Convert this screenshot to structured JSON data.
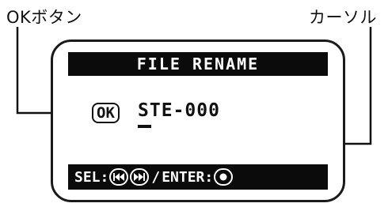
{
  "callouts": {
    "ok_button": "OKボタン",
    "cursor": "カーソル"
  },
  "screen": {
    "title": "FILE RENAME",
    "ok_label": "OK",
    "filename": "STE-000",
    "sel_label": "SEL:",
    "separator": "/",
    "enter_label": "ENTER:"
  },
  "icons": {
    "rewind": "rewind-button-icon",
    "fast_forward": "fast-forward-button-icon",
    "enter": "record-button-icon"
  }
}
